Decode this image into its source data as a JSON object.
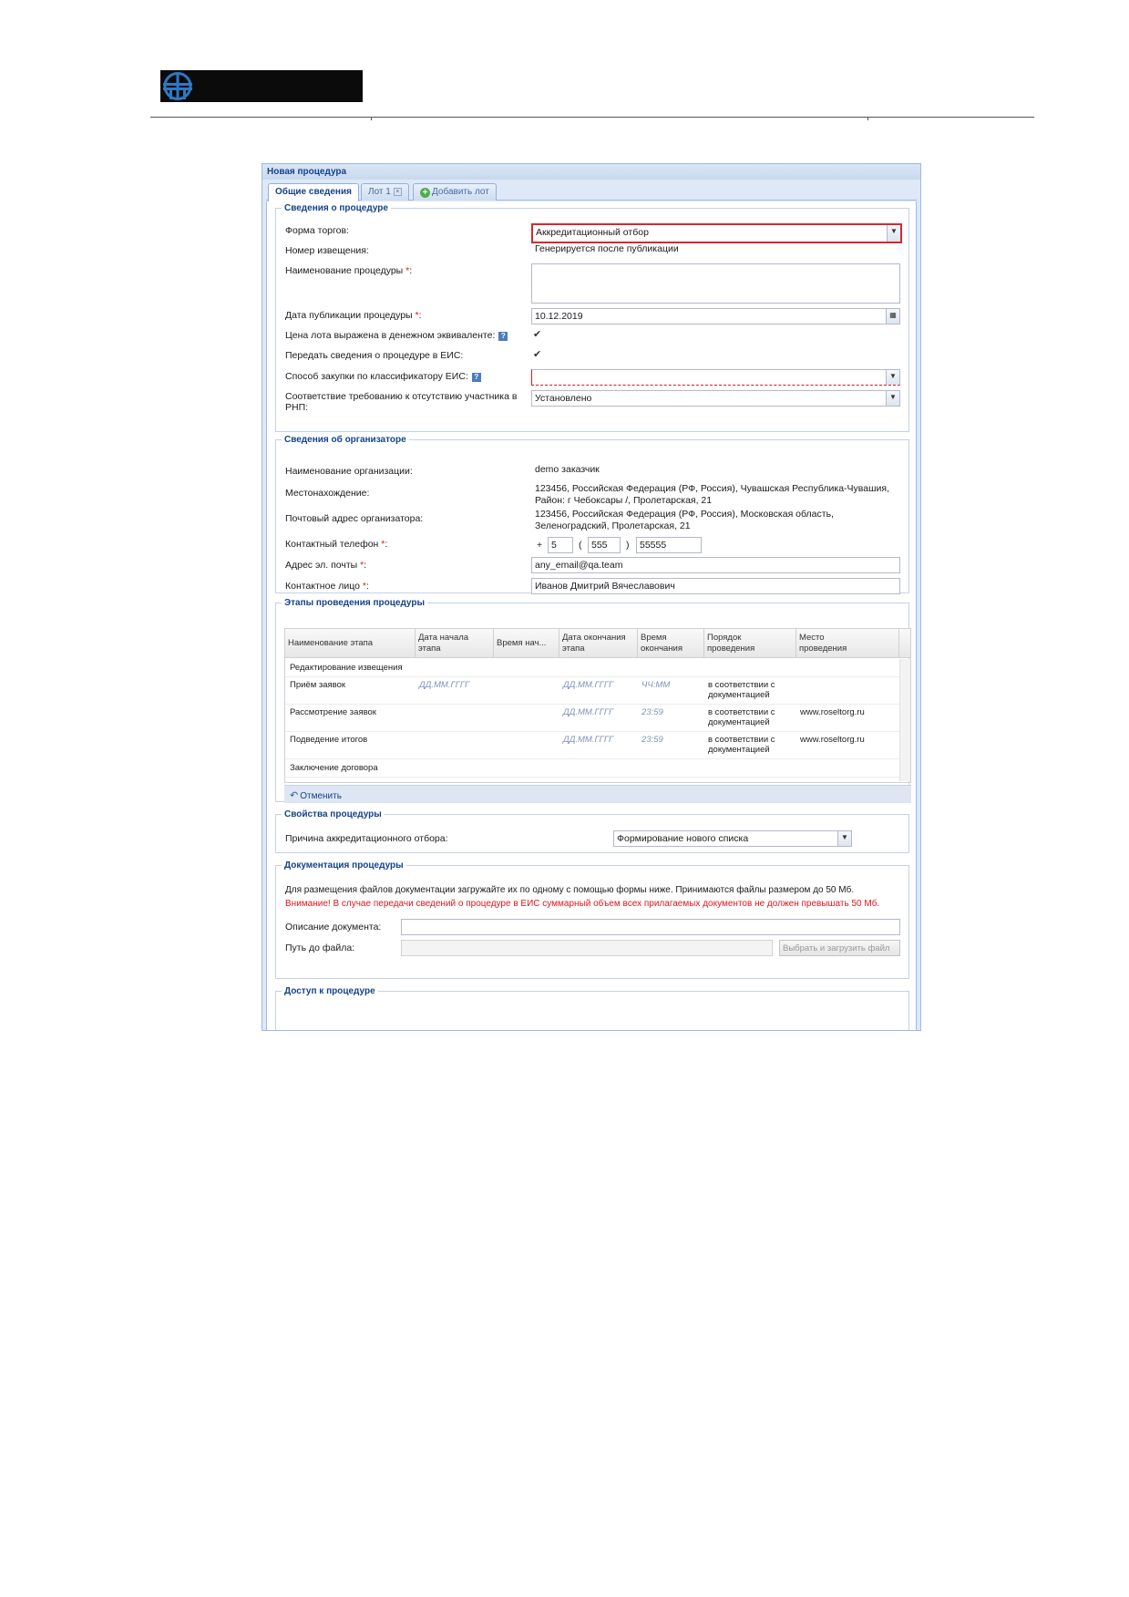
{
  "window": {
    "title": "Новая процедура"
  },
  "tabs": [
    {
      "label": "Общие сведения"
    },
    {
      "label": "Лот 1"
    },
    {
      "label": "Добавить лот"
    }
  ],
  "procedure": {
    "legend": "Сведения о процедуре",
    "form_label": "Форма торгов:",
    "form_value": "Аккредитационный отбор",
    "notice_label": "Номер извещения:",
    "notice_value": "Генерируется после публикации",
    "name_label": "Наименование процедуры",
    "date_label": "Дата публикации процедуры",
    "date_value": "10.12.2019",
    "price_label": "Цена лота выражена в денежном эквиваленте:",
    "eis_label": "Передать сведения о процедуре в ЕИС:",
    "method_label": "Способ закупки по классификатору ЕИС:",
    "rnp_label_1": "Соответствие требованию к отсутствию участника в",
    "rnp_label_2": "РНП:",
    "rnp_value": "Установлено",
    "required_mark": "*",
    "colon": ":"
  },
  "organizer": {
    "legend": "Сведения об организаторе",
    "org_label": "Наименование организации:",
    "org_value": "demo заказчик",
    "location_label": "Местонахождение:",
    "location_line1": "123456, Российская Федерация (РФ, Россия), Чувашская Республика-Чувашия,",
    "location_line2": "Район: г Чебоксары /, Пролетарская, 21",
    "postal_label": "Почтовый адрес организатора:",
    "postal_line1": "123456, Российская Федерация (РФ, Россия), Московская область,",
    "postal_line2": "Зеленоградский, Пролетарская, 21",
    "phone_label": "Контактный телефон",
    "phone_plus": "+",
    "phone_country": "5",
    "phone_open": "(",
    "phone_code": "555",
    "phone_close": ")",
    "phone_number": "55555",
    "email_label": "Адрес эл. почты",
    "email_value": "any_email@qa.team",
    "contact_label": "Контактное лицо",
    "contact_value": "Иванов Дмитрий Вячеславович"
  },
  "stages": {
    "legend": "Этапы проведения процедуры",
    "columns": [
      "Наименование этапа",
      "Дата начала этапа",
      "Время нач...",
      "Дата окончания этапа",
      "Время окончания",
      "Порядок проведения",
      "Место проведения"
    ],
    "columns_wrapped": [
      [
        "Наименование этапа"
      ],
      [
        "Дата начала",
        "этапа"
      ],
      [
        "Время нач..."
      ],
      [
        "Дата окончания",
        "этапа"
      ],
      [
        "Время",
        "окончания"
      ],
      [
        "Порядок",
        "проведения"
      ],
      [
        "Место",
        "проведения"
      ]
    ],
    "rows": [
      {
        "name": "Редактирование извещения",
        "start_date": "",
        "start_time": "",
        "end_date": "",
        "end_time": "",
        "order": [
          "",
          ""
        ],
        "place": ""
      },
      {
        "name": "Приём заявок",
        "start_date": "ДД.ММ.ГГГГ",
        "start_time": "",
        "end_date": "ДД.ММ.ГГГГ",
        "end_time": "ЧЧ:ММ",
        "order": [
          "в соответствии с",
          "документацией"
        ],
        "place": ""
      },
      {
        "name": "Рассмотрение заявок",
        "start_date": "",
        "start_time": "",
        "end_date": "ДД.ММ.ГГГГ",
        "end_time": "23:59",
        "order": [
          "в соответствии с",
          "документацией"
        ],
        "place": "www.roseltorg.ru"
      },
      {
        "name": "Подведение итогов",
        "start_date": "",
        "start_time": "",
        "end_date": "ДД.ММ.ГГГГ",
        "end_time": "23:59",
        "order": [
          "в соответствии с",
          "документацией"
        ],
        "place": "www.roseltorg.ru"
      },
      {
        "name": "Заключение договора",
        "start_date": "",
        "start_time": "",
        "end_date": "",
        "end_time": "",
        "order": [
          "",
          ""
        ],
        "place": ""
      }
    ],
    "undo_label": "Отменить"
  },
  "properties": {
    "legend": "Свойства процедуры",
    "reason_label": "Причина аккредитационного отбора:",
    "reason_value": "Формирование нового списка"
  },
  "documentation": {
    "legend": "Документация процедуры",
    "info": "Для размещения файлов документации загружайте их по одному с помощью формы ниже. Принимаются файлы размером до 50 Мб.",
    "warning": "Внимание! В случае передачи сведений о процедуре в ЕИС суммарный объем всех прилагаемых документов не должен превышать 50 Мб.",
    "desc_label": "Описание документа:",
    "path_label": "Путь до файла:",
    "upload_button": "Выбрать и загрузить файл"
  },
  "access": {
    "legend": "Доступ к процедуре"
  },
  "colors": {
    "accent": "#15428b",
    "required": "#e0161c",
    "highlight": "#d6282f",
    "panel": "#dfe8f6"
  }
}
